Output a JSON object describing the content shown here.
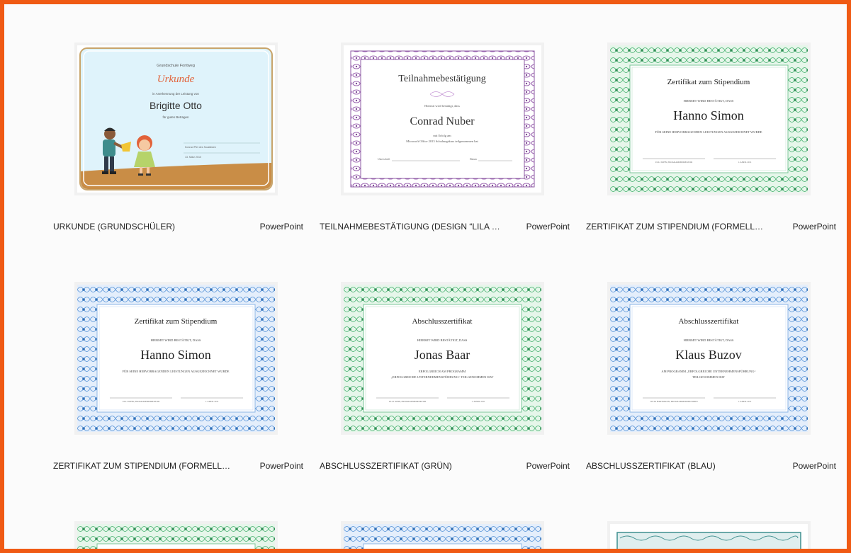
{
  "templates": [
    {
      "title": "URKUNDE (GRUNDSCHÜLER)",
      "app": "PowerPoint",
      "preview": {
        "school": "Grundschule Fontweg",
        "heading": "Urkunde",
        "line1": "in Anerkennung der Leistung von",
        "name": "Brigitte Otto",
        "line2": "für gutes Betragen",
        "sign_label": "Konrad Pfei des Sozialisten",
        "date": "13. März 2010"
      }
    },
    {
      "title": "TEILNAHMEBESTÄTIGUNG (DESIGN “LILA KE...",
      "app": "PowerPoint",
      "preview": {
        "heading": "Teilnahmebestätigung",
        "line1": "Hiermit wird bestätigt, dass",
        "name": "Conrad Nuber",
        "line2": "mit Erfolg am",
        "line3": "Microsoft Office 2013 Schulungskurs teilgenommen hat",
        "sign_label": "Unterschrift",
        "date_label": "Datum"
      }
    },
    {
      "title": "ZERTIFIKAT ZUM STIPENDIUM (FORMELLER ...",
      "app": "PowerPoint",
      "preview": {
        "heading": "Zertifikat zum Stipendium",
        "line1": "HIERMIT WIRD BESTÄTIGT, DASS",
        "name": "Hanno Simon",
        "line2": "FÜR SEINE HERVORRAGENDEN LEISTUNGEN AUSGEZEICHNET WURDE",
        "line3": "",
        "sign_label": "ULLI JOHN, PROGRAMMDIREKTOR",
        "date": "1. APRIL 2011"
      }
    },
    {
      "title": "ZERTIFIKAT ZUM STIPENDIUM (FORMELLER ...",
      "app": "PowerPoint",
      "preview": {
        "heading": "Zertifikat zum Stipendium",
        "line1": "HIERMIT WIRD BESTÄTIGT, DASS",
        "name": "Hanno Simon",
        "line2": "FÜR SEINE HERVORRAGENDEN LEISTUNGEN AUSGEZEICHNET WURDE",
        "line3": "",
        "sign_label": "ULLI JOHN, PROGRAMMDIREKTOR",
        "date": "1. APRIL 2011"
      }
    },
    {
      "title": "ABSCHLUSSZERTIFIKAT (GRÜN)",
      "app": "PowerPoint",
      "preview": {
        "heading": "Abschlusszertifikat",
        "line1": "HIERMIT WIRD BESTÄTIGT, DASS",
        "name": "Jonas Baar",
        "line2": "ERFOLGREICH AM PROGRAMM",
        "line3": "„ERFOLGREICHE UNTERNEHMENSFÜHRUNG“ TEILGENOMMEN HAT",
        "sign_label": "ULLI JOHN, PROGRAMMDIREKTOR",
        "date": "1. APRIL 2011"
      }
    },
    {
      "title": "ABSCHLUSSZERTIFIKAT (BLAU)",
      "app": "PowerPoint",
      "preview": {
        "heading": "Abschlusszertifikat",
        "line1": "HIERMIT WIRD BESTÄTIGT, DASS",
        "name": "Klaus Buzov",
        "line2": "AM PROGRAMM „ERFOLGREICHE UNTERNEHMENSFÜHRUNG“",
        "line3": "TEILGENOMMEN HAT",
        "sign_label": "JULIA HARTMANN, PROGRAMMDIREKTORIN",
        "date": "1. APRIL 2011"
      }
    }
  ],
  "colors": {
    "frame_orange": "#f05a14",
    "green": "#3fae6a",
    "blue": "#4f8fd6",
    "lilac": "#a06bb4"
  }
}
